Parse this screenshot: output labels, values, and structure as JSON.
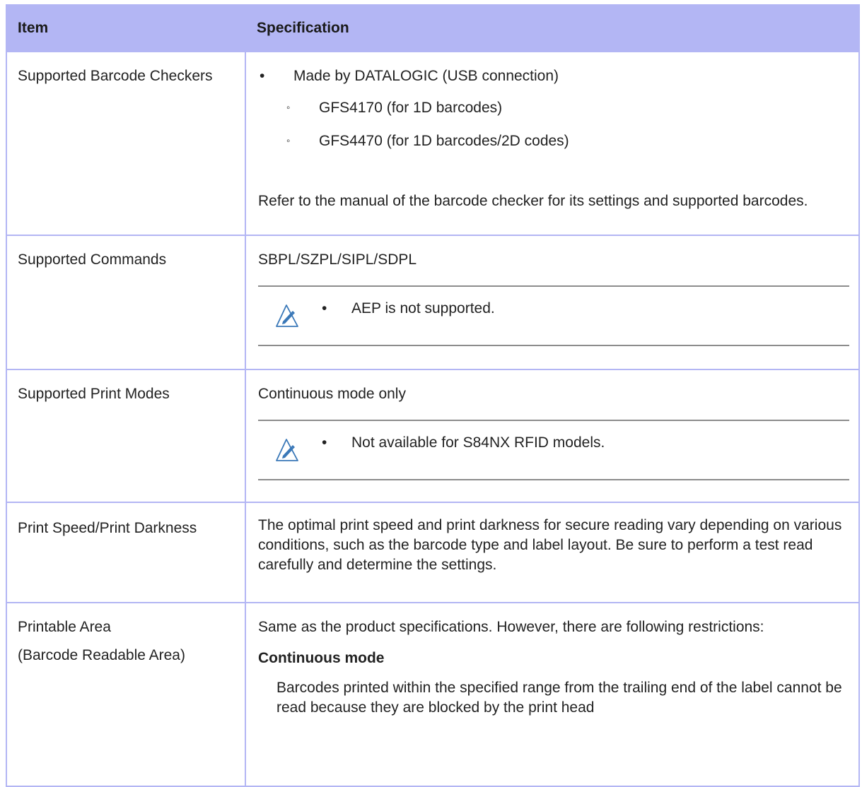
{
  "header": {
    "item": "Item",
    "specification": "Specification"
  },
  "rows": {
    "checkers": {
      "label": "Supported Barcode Checkers",
      "bullet": "Made by DATALOGIC (USB connection)",
      "sub1": "GFS4170 (for 1D barcodes)",
      "sub2": "GFS4470 (for 1D barcodes/2D codes)",
      "note": "Refer to the manual of the barcode checker for its settings and supported barcodes."
    },
    "commands": {
      "label": "Supported Commands",
      "value": "SBPL/SZPL/SIPL/SDPL",
      "note": "AEP is not supported."
    },
    "modes": {
      "label": "Supported Print Modes",
      "value": "Continuous mode only",
      "note": "Not available for S84NX RFID models."
    },
    "speed": {
      "label": "Print Speed/Print Darkness",
      "value": "The optimal print speed and print darkness for secure reading vary depending on various conditions, such as the barcode type and label layout. Be sure to perform a test read carefully and determine the settings."
    },
    "area": {
      "label": "Printable Area",
      "label2": "(Barcode Readable Area)",
      "value": "Same as the product specifications. However, there are following restrictions:",
      "subhead": "Continuous mode",
      "detail": "Barcodes printed within the specified range from the trailing end of the label cannot be read because they are blocked by the print head"
    }
  },
  "symbols": {
    "bullet": "•",
    "subbullet": "◦"
  },
  "icons": {
    "note": "pencil-note-icon"
  },
  "colors": {
    "header_bg": "#b3b6f4",
    "border": "#b3b6f4",
    "note_rule": "#8c8c8c",
    "icon_blue": "#3a78b8"
  }
}
